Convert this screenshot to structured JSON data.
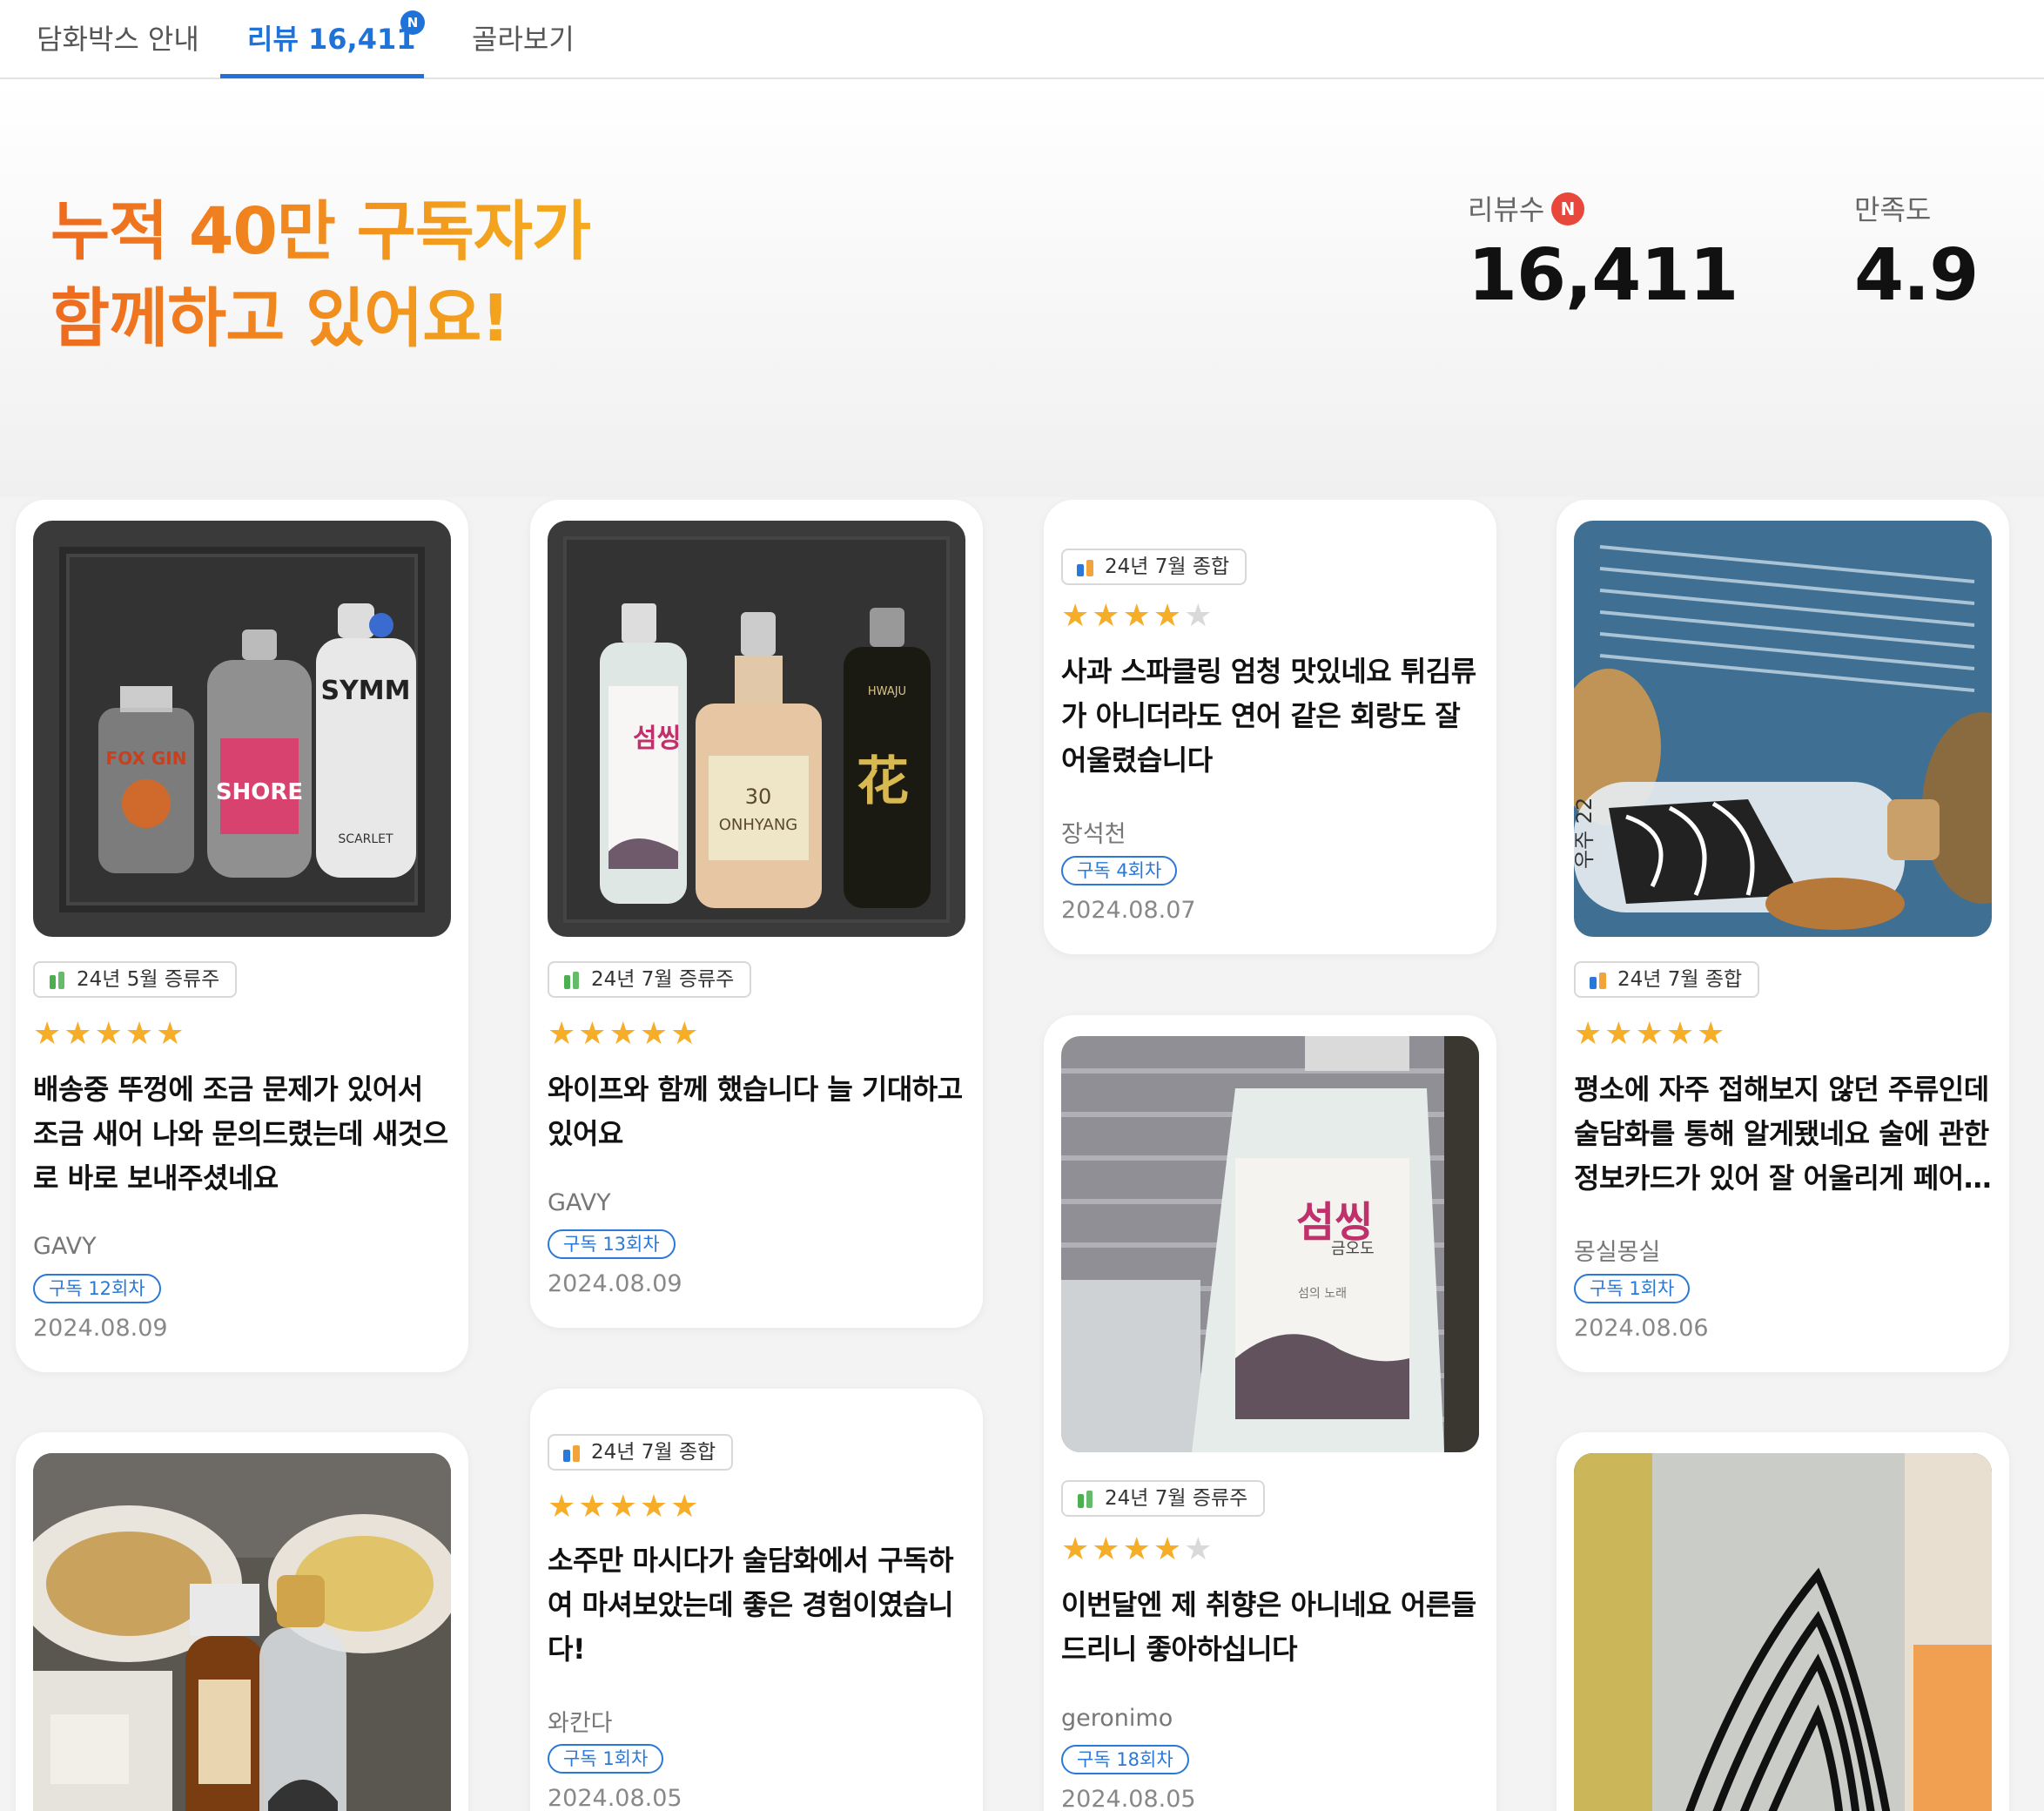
{
  "tabs": [
    {
      "label": "담화박스 안내",
      "active": false
    },
    {
      "label": "리뷰 16,411",
      "active": true,
      "badge": "N"
    },
    {
      "label": "골라보기",
      "active": false
    }
  ],
  "hero": {
    "headline_line1": "누적 40만 구독자가",
    "headline_line2": "함께하고 있어요!",
    "review_count_label": "리뷰수",
    "review_count_badge": "N",
    "review_count": "16,411",
    "satisfaction_label": "만족도",
    "satisfaction": "4.9"
  },
  "colors": {
    "accent_blue": "#1f73d8",
    "headline_orange": "#ee6a1f",
    "star_gold": "#f6ae28",
    "badge_red": "#e8473b"
  },
  "reviews": [
    {
      "tag": "24년 5월 증류주",
      "tag_icon": "green-bottle-icon",
      "rating": 5,
      "text": "배송중 뚜껑에 조금 문제가 있어서 조금 새어 나와 문의드렸는데 새것으로 바로 보내주셨네요",
      "author": "GAVY",
      "subscription": "구독 12회차",
      "date": "2024.08.09"
    },
    {
      "tag": "24년 7월 증류주",
      "tag_icon": "green-bottle-icon",
      "rating": 5,
      "text": "와이프와 함께 했습니다 늘 기대하고 있어요",
      "author": "GAVY",
      "subscription": "구독 13회차",
      "date": "2024.08.09"
    },
    {
      "tag": "24년 7월 종합",
      "tag_icon": "mixed-bottles-icon",
      "rating": 4,
      "text": "사과 스파클링 엄청 맛있네요 튀김류가 아니더라도 연어 같은 회랑도 잘 어울렸습니다",
      "author": "장석천",
      "subscription": "구독 4회차",
      "date": "2024.08.07"
    },
    {
      "tag": "24년 7월 종합",
      "tag_icon": "mixed-bottles-icon",
      "rating": 5,
      "text": "평소에 자주 접해보지 않던 주류인데 술담화를 통해 알게됐네요 술에 관한 정보카드가 있어 잘 어울리게 페어링할 수 있었어요",
      "author": "몽실몽실",
      "subscription": "구독 1회차",
      "date": "2024.08.06"
    },
    {
      "tag": "24년 7월 종합",
      "tag_icon": "mixed-bottles-icon",
      "rating": 5,
      "text": "소주만 마시다가 술담화에서 구독하여 마셔보았는데 좋은 경험이였습니다!",
      "author": "와칸다",
      "subscription": "구독 1회차",
      "date": "2024.08.05"
    },
    {
      "tag": "24년 7월 증류주",
      "tag_icon": "green-bottle-icon",
      "rating": 4,
      "text": "이번달엔 제 취향은 아니네요 어른들 드리니 좋아하십니다",
      "author": "geronimo",
      "subscription": "구독 18회차",
      "date": "2024.08.05"
    }
  ],
  "photo_labels": {
    "gin_box": [
      "FOX GIN",
      "SHORE",
      "SYMM",
      "SCARLET"
    ],
    "spirits_box": [
      "섬씽",
      "금오도",
      "30",
      "ONHYANG",
      "HWAJU",
      "花"
    ],
    "leaflet_bottle": [
      "우주 22"
    ],
    "closeup_bottle": [
      "섬씽",
      "금오도",
      "섬의 노래"
    ]
  }
}
